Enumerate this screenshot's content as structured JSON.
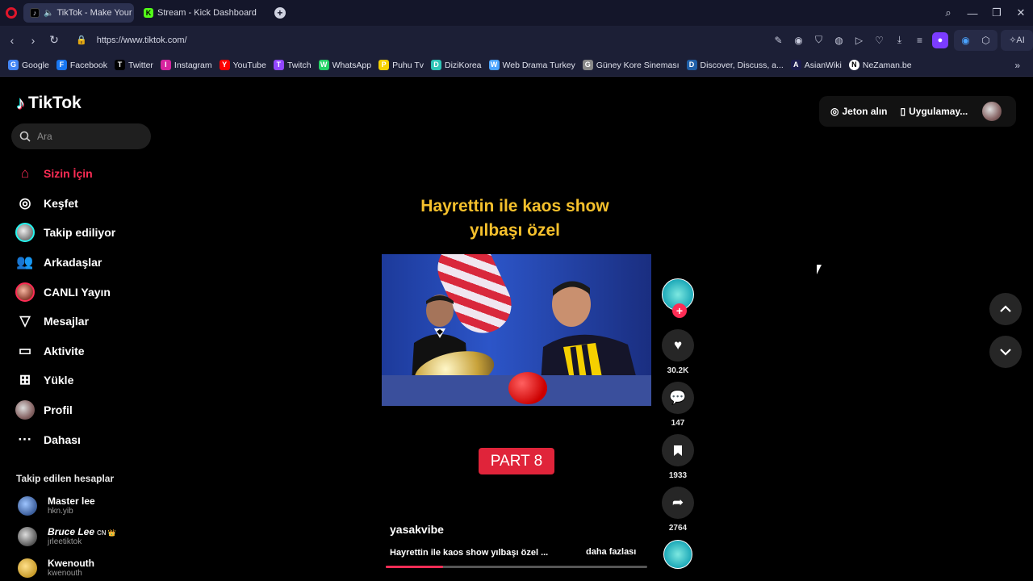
{
  "browser": {
    "tabs": [
      {
        "title": "TikTok - Make Your Da",
        "active": true
      },
      {
        "title": "Stream - Kick Dashboard",
        "active": false
      }
    ],
    "url": "https://www.tiktok.com/",
    "bookmarks": [
      {
        "label": "Google",
        "icon": "google-icon",
        "color": "#4285f4"
      },
      {
        "label": "Facebook",
        "icon": "facebook-icon",
        "color": "#1877f2"
      },
      {
        "label": "Twitter",
        "icon": "x-icon",
        "color": "#000000"
      },
      {
        "label": "Instagram",
        "icon": "instagram-icon",
        "color": "#d6249f"
      },
      {
        "label": "YouTube",
        "icon": "youtube-icon",
        "color": "#ff0000"
      },
      {
        "label": "Twitch",
        "icon": "twitch-icon",
        "color": "#9146ff"
      },
      {
        "label": "WhatsApp",
        "icon": "whatsapp-icon",
        "color": "#25d366"
      },
      {
        "label": "Puhu Tv",
        "icon": "puhutv-icon",
        "color": "#f6d200"
      },
      {
        "label": "DiziKorea",
        "icon": "dizikorea-icon",
        "color": "#2ec4b6"
      },
      {
        "label": "Web Drama Turkey",
        "icon": "webdrama-icon",
        "color": "#4aa3ff"
      },
      {
        "label": "Güney Kore Sineması",
        "icon": "sinema-icon",
        "color": "#888888"
      },
      {
        "label": "Discover, Discuss, a...",
        "icon": "mdl-icon",
        "color": "#1f5fa8"
      },
      {
        "label": "AsianWiki",
        "icon": "asianwiki-icon",
        "color": "#1b1b4d"
      },
      {
        "label": "NeZaman.be",
        "icon": "nezaman-icon",
        "color": "#ffffff"
      }
    ]
  },
  "tiktok": {
    "logo": "TikTok",
    "search_placeholder": "Ara",
    "nav": [
      {
        "label": "Sizin İçin",
        "icon": "home-icon",
        "glyph": "⌂",
        "active": true
      },
      {
        "label": "Keşfet",
        "icon": "compass-icon",
        "glyph": "◎",
        "active": false
      },
      {
        "label": "Takip ediliyor",
        "icon": "following-avatar",
        "glyph": "",
        "active": false
      },
      {
        "label": "Arkadaşlar",
        "icon": "friends-icon",
        "glyph": "👥",
        "active": false
      },
      {
        "label": "CANLI Yayın",
        "icon": "live-avatar",
        "glyph": "",
        "active": false
      },
      {
        "label": "Mesajlar",
        "icon": "send-icon",
        "glyph": "▽",
        "active": false
      },
      {
        "label": "Aktivite",
        "icon": "activity-icon",
        "glyph": "▭",
        "active": false
      },
      {
        "label": "Yükle",
        "icon": "upload-icon",
        "glyph": "⊞",
        "active": false
      },
      {
        "label": "Profil",
        "icon": "profile-avatar",
        "glyph": "",
        "active": false
      },
      {
        "label": "Dahası",
        "icon": "more-icon",
        "glyph": "···",
        "active": false
      }
    ],
    "following_title": "Takip edilen hesaplar",
    "following": [
      {
        "name": "Master lee",
        "username": "hkn.yib",
        "badge": ""
      },
      {
        "name": "Bruce Lee",
        "username": "jrleetiktok",
        "badge": "CN 👑"
      },
      {
        "name": "Kwenouth",
        "username": "kwenouth",
        "badge": ""
      }
    ],
    "top_buttons": {
      "coins": "Jeton alın",
      "app": "Uygulamay..."
    },
    "video": {
      "caption_line1": "Hayrettin ile kaos show",
      "caption_line2": "yılbaşı özel",
      "part_label": "PART 8",
      "author": "yasakvibe",
      "description": "Hayrettin ile kaos show yılbaşı özel ...",
      "more": "daha fazlası",
      "progress": 0.22
    },
    "actions": {
      "likes": "30.2K",
      "comments": "147",
      "saves": "1933",
      "shares": "2764"
    }
  }
}
